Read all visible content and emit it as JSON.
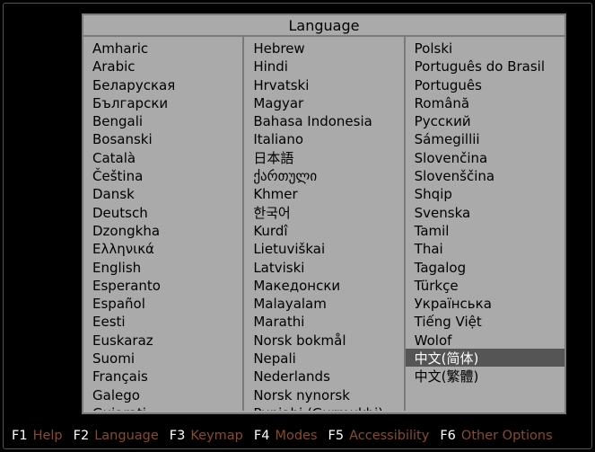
{
  "title": "Language",
  "selected": "中文(简体)",
  "columns": [
    [
      "Amharic",
      "Arabic",
      "Беларуская",
      "Български",
      "Bengali",
      "Bosanski",
      "Català",
      "Čeština",
      "Dansk",
      "Deutsch",
      "Dzongkha",
      "Ελληνικά",
      "English",
      "Esperanto",
      "Español",
      "Eesti",
      "Euskaraz",
      "Suomi",
      "Français",
      "Galego",
      "Gujarati"
    ],
    [
      "Hebrew",
      "Hindi",
      "Hrvatski",
      "Magyar",
      "Bahasa Indonesia",
      "Italiano",
      "日本語",
      "ქართული",
      "Khmer",
      "한국어",
      "Kurdî",
      "Lietuviškai",
      "Latviski",
      "Македонски",
      "Malayalam",
      "Marathi",
      "Norsk bokmål",
      "Nepali",
      "Nederlands",
      "Norsk nynorsk",
      "Punjabi (Gurmukhi)"
    ],
    [
      "Polski",
      "Português do Brasil",
      "Português",
      "Română",
      "Русский",
      "Sámegillii",
      "Slovenčina",
      "Slovenščina",
      "Shqip",
      "Svenska",
      "Tamil",
      "Thai",
      "Tagalog",
      "Türkçe",
      "Українська",
      "Tiếng Việt",
      "Wolof",
      "中文(简体)",
      "中文(繁體)"
    ]
  ],
  "footer": [
    {
      "key": "F1",
      "label": "Help"
    },
    {
      "key": "F2",
      "label": "Language"
    },
    {
      "key": "F3",
      "label": "Keymap"
    },
    {
      "key": "F4",
      "label": "Modes"
    },
    {
      "key": "F5",
      "label": "Accessibility"
    },
    {
      "key": "F6",
      "label": "Other Options"
    }
  ]
}
